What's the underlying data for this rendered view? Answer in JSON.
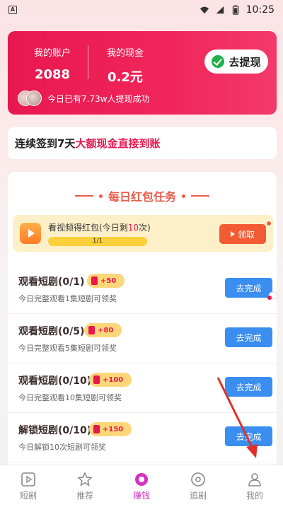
{
  "status_bar": {
    "notification_badge": "A",
    "time": "10:25"
  },
  "balance": {
    "account_label": "我的账户",
    "account_value": "2088",
    "cash_label": "我的现金",
    "cash_value": "0.2元",
    "withdraw_label": "去提现",
    "ticker_text": "今日已有7.73w人提现成功"
  },
  "signin": {
    "part1": "连续签到7天",
    "highlight": "大额现金直接到账"
  },
  "tasks": {
    "title": "每日红包任务",
    "video": {
      "label_prefix": "看视频得红包(今日剩",
      "remaining": "10",
      "label_suffix": "次)",
      "progress_text": "1/1",
      "progress": 1.0,
      "claim_label": "领取"
    },
    "items": [
      {
        "name": "观看短剧(0/1)",
        "reward": "+50",
        "desc": "今日完整观看1集短剧可领奖",
        "button": "去完成"
      },
      {
        "name": "观看短剧(0/5)",
        "reward": "+80",
        "desc": "今日完整观看5集短剧可领奖",
        "button": "去完成"
      },
      {
        "name": "观看短剧(0/10)",
        "reward": "+100",
        "desc": "今日完整观看10集短剧可领奖",
        "button": "去完成"
      },
      {
        "name": "解锁短剧(0/10)",
        "reward": "+150",
        "desc": "今日解锁10次短剧可领奖",
        "button": "去完成"
      }
    ]
  },
  "nav": {
    "items": [
      {
        "label": "短剧",
        "icon": "play-square-icon"
      },
      {
        "label": "推荐",
        "icon": "star-icon"
      },
      {
        "label": "赚钱",
        "icon": "coin-icon",
        "active": true
      },
      {
        "label": "追剧",
        "icon": "disc-icon"
      },
      {
        "label": "我的",
        "icon": "user-icon"
      }
    ]
  },
  "colors": {
    "brand_red": "#e8184f",
    "task_blue": "#3a8ef0",
    "active_nav": "#d631c3",
    "claim_orange": "#f25b33"
  }
}
